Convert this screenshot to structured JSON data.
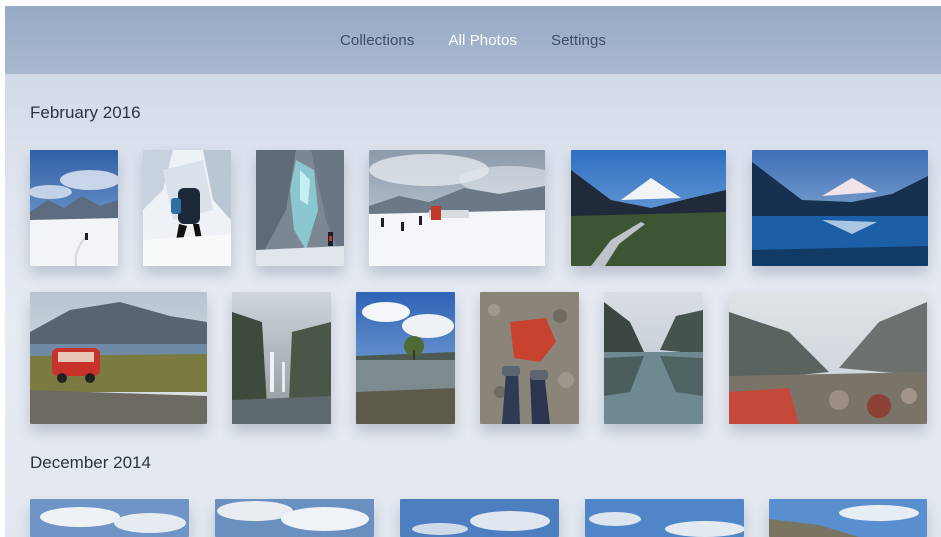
{
  "nav": {
    "tabs": [
      {
        "label": "Collections",
        "selected": false
      },
      {
        "label": "All Photos",
        "selected": true
      },
      {
        "label": "Settings",
        "selected": false
      }
    ]
  },
  "sections": [
    {
      "title": "February 2016"
    },
    {
      "title": "December 2014"
    }
  ],
  "colors": {
    "nav_bar": "#a3b4cb",
    "tab_text": "#3f4e66",
    "tab_selected": "#ffffff",
    "section_title": "#2d3440"
  }
}
